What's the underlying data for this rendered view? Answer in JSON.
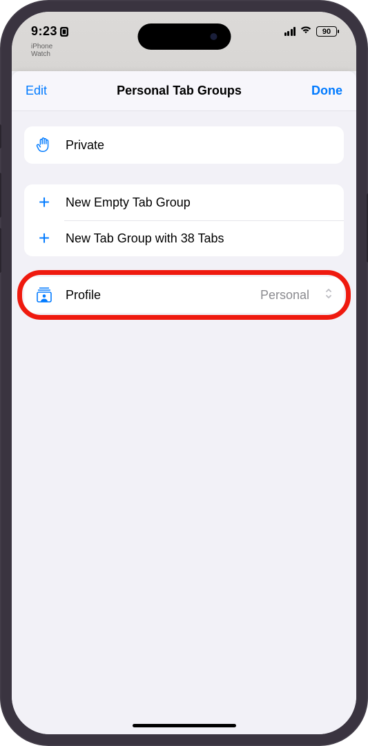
{
  "status_bar": {
    "time": "9:23",
    "battery": "90",
    "blur_line1": "iPhone",
    "blur_line2": "Watch"
  },
  "sheet": {
    "edit": "Edit",
    "title": "Personal Tab Groups",
    "done": "Done"
  },
  "private": {
    "label": "Private"
  },
  "actions": {
    "new_empty": "New Empty Tab Group",
    "new_with_tabs": "New Tab Group with 38 Tabs"
  },
  "profile": {
    "label": "Profile",
    "value": "Personal"
  }
}
